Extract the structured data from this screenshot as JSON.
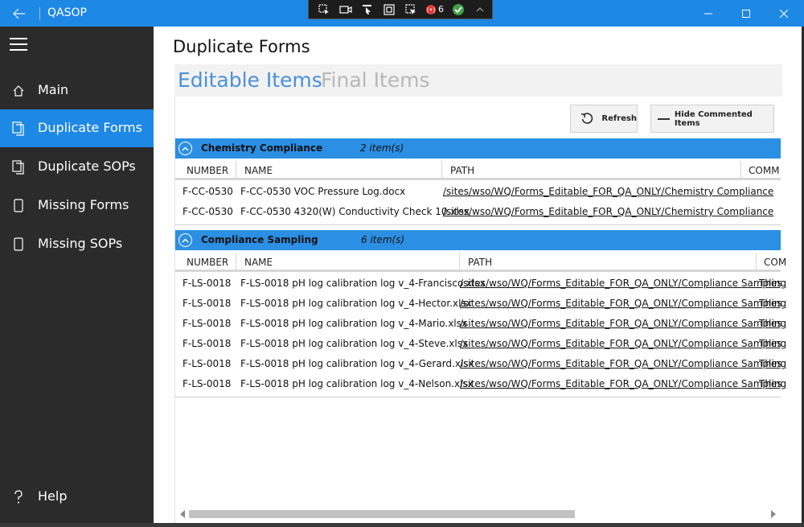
{
  "window": {
    "title": "QASOP",
    "error_count": "6"
  },
  "sidebar": {
    "items": [
      {
        "label": "Main",
        "icon": "home-icon"
      },
      {
        "label": "Duplicate Forms",
        "icon": "documents-icon",
        "active": true
      },
      {
        "label": "Duplicate SOPs",
        "icon": "documents-icon"
      },
      {
        "label": "Missing Forms",
        "icon": "document-icon"
      },
      {
        "label": "Missing SOPs",
        "icon": "document-icon"
      }
    ],
    "help_label": "Help"
  },
  "main": {
    "title": "Duplicate Forms",
    "tabs": [
      {
        "label": "Editable Items",
        "selected": true
      },
      {
        "label": "Final Items",
        "selected": false
      }
    ],
    "toolbar": {
      "refresh_label": "Refresh",
      "hide_label": "Hide Commented Items"
    }
  },
  "groups": [
    {
      "name": "Chemistry Compliance",
      "count": "2 item(s)",
      "columns": [
        "NUMBER",
        "NAME",
        "PATH",
        "COMM"
      ],
      "rows": [
        {
          "number": "F-CC-0530",
          "name": "F-CC-0530 VOC Pressure Log.docx",
          "path": "/sites/wso/WQ/Forms_Editable_FOR_QA_ONLY/Chemistry Compliance",
          "comment": ""
        },
        {
          "number": "F-CC-0530",
          "name": "F-CC-0530 4320(W) Conductivity Check 10.xlsx",
          "path": "/sites/wso/WQ/Forms_Editable_FOR_QA_ONLY/Chemistry Compliance",
          "comment": ""
        }
      ]
    },
    {
      "name": "Compliance Sampling",
      "count": "6 item(s)",
      "columns": [
        "NUMBER",
        "NAME",
        "PATH",
        "COM"
      ],
      "rows": [
        {
          "number": "F-LS-0018",
          "name": "F-LS-0018 pH log calibration log v_4-Francisco.xlsx",
          "path": "/sites/wso/WQ/Forms_Editable_FOR_QA_ONLY/Compliance Sampling",
          "comment": "Thes"
        },
        {
          "number": "F-LS-0018",
          "name": "F-LS-0018 pH log calibration log v_4-Hector.xlsx",
          "path": "/sites/wso/WQ/Forms_Editable_FOR_QA_ONLY/Compliance Sampling",
          "comment": "Thes"
        },
        {
          "number": "F-LS-0018",
          "name": "F-LS-0018 pH log calibration log v_4-Mario.xlsx",
          "path": "/sites/wso/WQ/Forms_Editable_FOR_QA_ONLY/Compliance Sampling",
          "comment": "Thes"
        },
        {
          "number": "F-LS-0018",
          "name": "F-LS-0018 pH log calibration log v_4-Steve.xlsx",
          "path": "/sites/wso/WQ/Forms_Editable_FOR_QA_ONLY/Compliance Sampling",
          "comment": "Thes"
        },
        {
          "number": "F-LS-0018",
          "name": "F-LS-0018 pH log calibration log v_4-Gerard.xlsx",
          "path": "/sites/wso/WQ/Forms_Editable_FOR_QA_ONLY/Compliance Sampling",
          "comment": "Thes"
        },
        {
          "number": "F-LS-0018",
          "name": "F-LS-0018 pH log calibration log v_4-Nelson.xlsx",
          "path": "/sites/wso/WQ/Forms_Editable_FOR_QA_ONLY/Compliance Sampling",
          "comment": "Thes"
        }
      ]
    }
  ],
  "colors": {
    "accent": "#1e88e5",
    "group_header": "#2b8fe4",
    "sidebar_bg": "#2b2b2b",
    "tab_selected": "#4a90d9",
    "tab_unselected": "#b8b8b8"
  }
}
